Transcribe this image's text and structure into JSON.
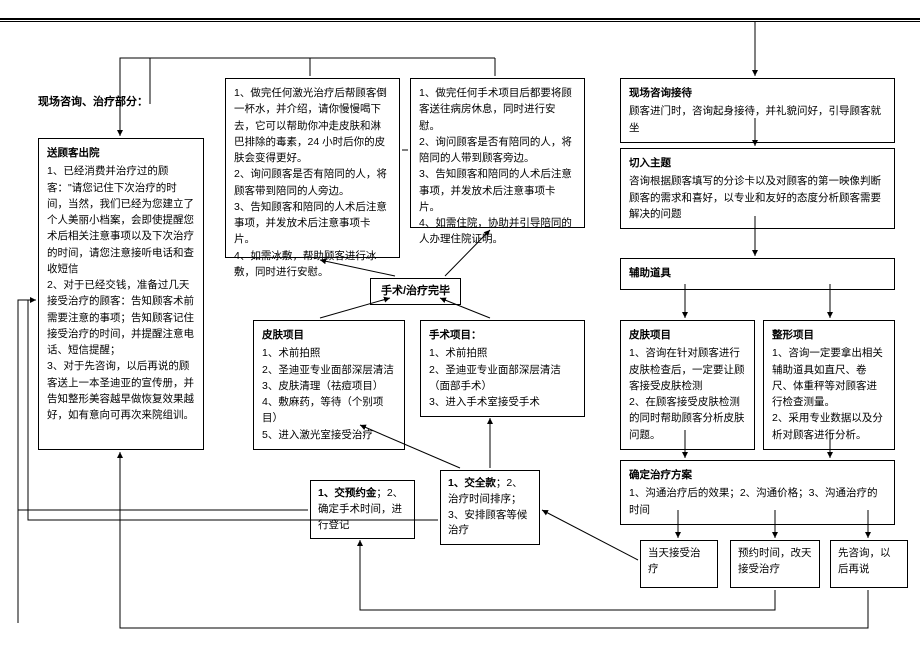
{
  "section_label": "现场咨询、治疗部分：",
  "discharge": {
    "title": "送顾客出院",
    "body": "1、已经消费并治疗过的顾客：\"请您记住下次治疗的时间，当然，我们已经为您建立了个人美丽小档案，会即使提醒您术后相关注意事项以及下次治疗的时间，请您注意接听电话和查收短信\n2、对于已经交钱，准备过几天接受治疗的顾客：告知顾客术前需要注意的事项；告知顾客记住接受治疗的时间，并提醒注意电话、短信提醒；\n3、对于先咨询，以后再说的顾客送上一本圣迪亚的宣传册，并告知整形美容越早做恢复效果越好，如有意向可再次来院组训。"
  },
  "col2_top": "1、做完任何激光治疗后帮顾客倒一杯水，并介绍，请你慢慢喝下去，它可以帮助你冲走皮肤和淋巴排除的毒素，24 小时后你的皮肤会变得更好。\n2、询问顾客是否有陪同的人，将顾客带到陪同的人旁边。\n3、告知顾客和陪同的人术后注意事项，并发放术后注意事项卡片。\n4、如需冰敷，帮助顾客进行冰敷，同时进行安慰。",
  "col3_top": "1、做完任何手术项目后都要将顾客送往病房休息，同时进行安慰。\n2、询问顾客是否有陪同的人，将陪同的人带到顾客旁边。\n3、告知顾客和陪同的人术后注意事项，并发放术后注意事项卡片。\n4、如需住院，协助并引导陪同的人办理住院证明。",
  "reception": {
    "title": "现场咨询接待",
    "body": "顾客进门时，咨询起身接待，并礼貌问好，引导顾客就坐"
  },
  "topic": {
    "title": "切入主题",
    "body": "咨询根据顾客填写的分诊卡以及对顾客的第一映像判断顾客的需求和喜好，以专业和友好的态度分析顾客需要解决的问题"
  },
  "aux": {
    "title": "辅助道具"
  },
  "done_label": "手术/治疗完毕",
  "skin_proj": {
    "title": "皮肤项目",
    "body": "1、术前拍照\n2、圣迪亚专业面部深层清洁\n3、皮肤清理（祛痘项目）\n4、敷麻药，等待（个别项目）\n5、进入激光室接受治疗"
  },
  "surg_proj": {
    "title": "手术项目：",
    "body": "1、术前拍照\n2、圣迪亚专业面部深层清洁（面部手术）\n3、进入手术室接受手术"
  },
  "skin_right": {
    "title": "皮肤项目",
    "body": "1、咨询在针对顾客进行皮肤检查后，一定要让顾客接受皮肤检测\n2、在顾客接受皮肤检测的同时帮助顾客分析皮肤问题。"
  },
  "plastic_right": {
    "title": "整形项目",
    "body": "1、咨询一定要拿出相关辅助道具如直尺、卷尺、体重秤等对顾客进行检查测量。\n2、采用专业数据以及分析对顾客进行分析。"
  },
  "plan": {
    "title": "确定治疗方案",
    "body": "1、沟通治疗后的效果；2、沟通价格；3、沟通治疗的时间"
  },
  "pay_deposit": "1、交预约金；2、确定手术时间，进行登记",
  "pay_full": "1、交全款；2、治疗时间排序；3、安排顾客等候治疗",
  "opt_now": "当天接受治疗",
  "opt_later": "预约时间，改天接受治疗",
  "opt_consult": "先咨询，以后再说",
  "bold_parts": {
    "deposit_head": "1、交预约金",
    "full_head": "1、交全款"
  }
}
